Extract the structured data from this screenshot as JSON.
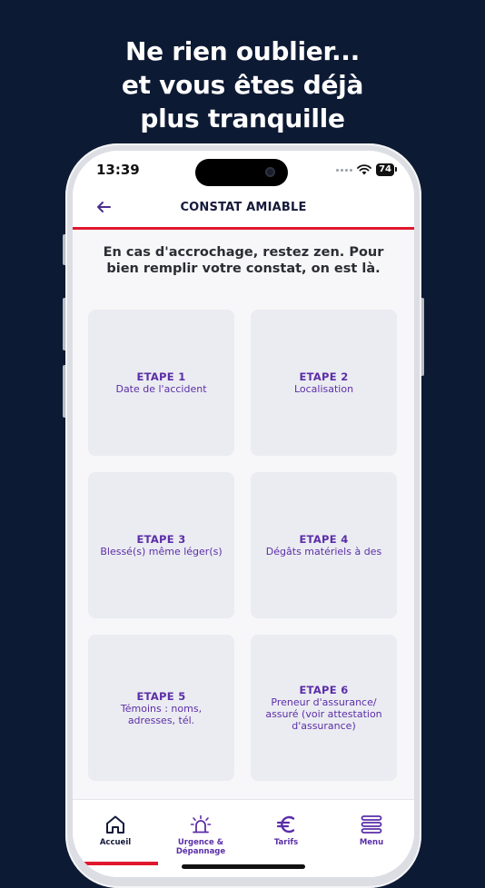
{
  "headline": {
    "line1": "Ne rien oublier...",
    "line2": "et vous êtes déjà",
    "line3": "plus tranquille"
  },
  "status_bar": {
    "time": "13:39",
    "battery": "74"
  },
  "app_bar": {
    "title": "CONSTAT AMIABLE"
  },
  "intro_text": "En cas d'accrochage, restez zen. Pour bien remplir votre constat, on est là.",
  "steps": [
    {
      "title": "ETAPE 1",
      "description": "Date de l'accident"
    },
    {
      "title": "ETAPE 2",
      "description": "Localisation"
    },
    {
      "title": "ETAPE 3",
      "description": "Blessé(s) même léger(s)"
    },
    {
      "title": "ETAPE 4",
      "description": "Dégâts matériels à des"
    },
    {
      "title": "ETAPE 5",
      "description": "Témoins : noms,\nadresses, tél."
    },
    {
      "title": "ETAPE 6",
      "description": "Preneur d'assurance/\nassuré (voir attestation\nd'assurance)"
    }
  ],
  "tab_bar": {
    "items": [
      {
        "label": "Accueil",
        "icon": "home-icon",
        "active": true
      },
      {
        "label": "Urgence &\nDépannage",
        "icon": "siren-icon",
        "active": false
      },
      {
        "label": "Tarifs",
        "icon": "euro-icon",
        "active": false
      },
      {
        "label": "Menu",
        "icon": "menu-icon",
        "active": false
      }
    ]
  },
  "colors": {
    "background": "#0d1a33",
    "accent_red": "#e0182d",
    "accent_purple": "#5b2ea8",
    "card_bg": "#ebecf1"
  }
}
